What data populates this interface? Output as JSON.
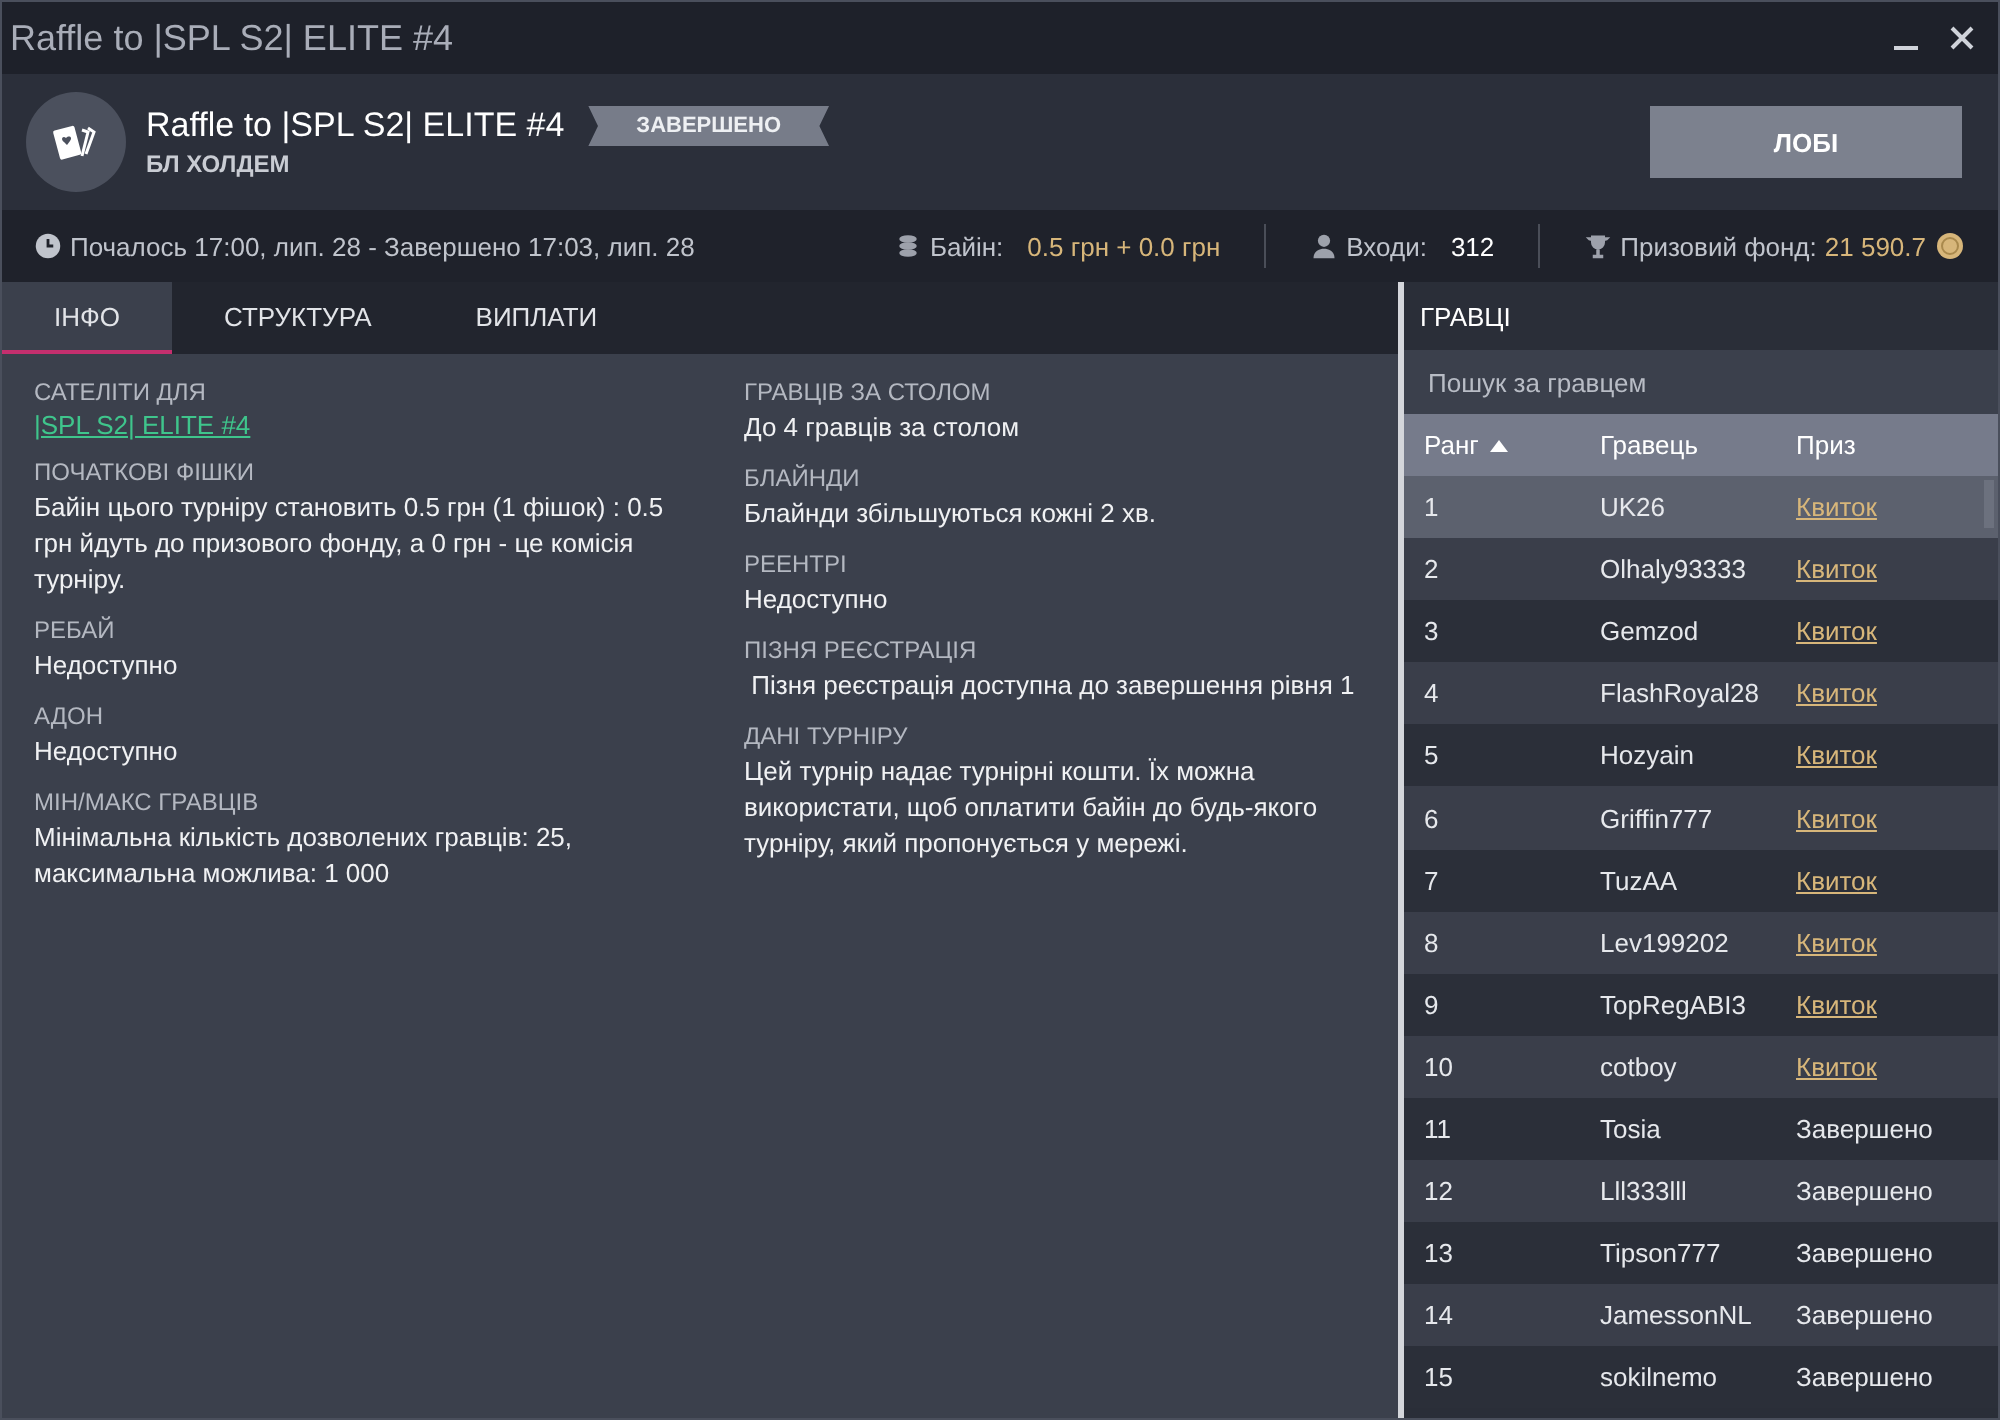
{
  "window": {
    "title": "Raffle to |SPL S2| ELITE #4"
  },
  "header": {
    "title": "Raffle to |SPL S2| ELITE #4",
    "status": "ЗАВЕРШЕНО",
    "game": "БЛ ХОЛДЕМ",
    "lobby_button": "ЛОБІ"
  },
  "info_bar": {
    "time": "Почалось 17:00, лип. 28  -  Завершено 17:03, лип. 28",
    "buyin_label": "Байін:",
    "buyin_value": "0.5 грн + 0.0 грн",
    "entries_label": "Входи:",
    "entries_value": "312",
    "prize_label": "Призовий фонд:",
    "prize_value": "21 590.7"
  },
  "tabs": [
    {
      "label": "ІНФО",
      "selected": true
    },
    {
      "label": "СТРУКТУРА",
      "selected": false
    },
    {
      "label": "ВИПЛАТИ",
      "selected": false
    }
  ],
  "info_columns": [
    [
      {
        "label": "САТЕЛІТИ ДЛЯ",
        "value": "|SPL S2| ELITE #4",
        "kind": "link"
      },
      {
        "label": "ПОЧАТКОВІ ФІШКИ",
        "value": "Байін цього турніру становить 0.5 грн (1 фішок) : 0.5 грн йдуть до призового фонду, а 0 грн - це комісія турніру.",
        "kind": "text"
      },
      {
        "label": "РЕБАЙ",
        "value": "Недоступно",
        "kind": "text"
      },
      {
        "label": "АДОН",
        "value": "Недоступно",
        "kind": "text"
      },
      {
        "label": "МІН/МАКС ГРАВЦІВ",
        "value": "Мінімальна кількість дозволених гравців: 25, максимальна можлива: 1 000",
        "kind": "text"
      }
    ],
    [
      {
        "label": "ГРАВЦІВ ЗА СТОЛОМ",
        "value": "До 4 гравців за столом",
        "kind": "text"
      },
      {
        "label": "БЛАЙНДИ",
        "value": "Блайнди збільшуються кожні 2 хв.",
        "kind": "text"
      },
      {
        "label": "РЕЕНТРІ",
        "value": "Недоступно",
        "kind": "text"
      },
      {
        "label": "ПІЗНЯ РЕЄСТРАЦІЯ",
        "value": " Пізня реєстрація доступна до завершення рівня 1",
        "kind": "text"
      },
      {
        "label": "ДАНІ ТУРНІРУ",
        "value": "Цей турнір надає турнірні кошти. Їх можна використати, щоб оплатити байін до будь-якого турніру, який пропонується у мережі.",
        "kind": "text"
      }
    ]
  ],
  "players": {
    "title": "ГРАВЦІ",
    "search": {
      "placeholder": "Пошук за гравцем"
    },
    "columns": [
      {
        "label": "Ранг",
        "sorted": true
      },
      {
        "label": "Гравець",
        "sorted": false
      },
      {
        "label": "Приз",
        "sorted": false
      }
    ],
    "rows": [
      {
        "rank": "1",
        "name": "UK26",
        "prize": "Квиток",
        "kind": "link",
        "selected": true
      },
      {
        "rank": "2",
        "name": "Olhaly93333",
        "prize": "Квиток",
        "kind": "link",
        "selected": false
      },
      {
        "rank": "3",
        "name": "Gemzod",
        "prize": "Квиток",
        "kind": "link",
        "selected": false
      },
      {
        "rank": "4",
        "name": "FlashRoyal28",
        "prize": "Квиток",
        "kind": "link",
        "selected": false
      },
      {
        "rank": "5",
        "name": "Hozyain",
        "prize": "Квиток",
        "kind": "link",
        "selected": false
      },
      {
        "rank": "6",
        "name": "Griffin777",
        "prize": "Квиток",
        "kind": "link",
        "selected": false
      },
      {
        "rank": "7",
        "name": "TuzAA",
        "prize": "Квиток",
        "kind": "link",
        "selected": false
      },
      {
        "rank": "8",
        "name": "Lev199202",
        "prize": "Квиток",
        "kind": "link",
        "selected": false
      },
      {
        "rank": "9",
        "name": "TopRegABI3",
        "prize": "Квиток",
        "kind": "link",
        "selected": false
      },
      {
        "rank": "10",
        "name": "cotboy",
        "prize": "Квиток",
        "kind": "link",
        "selected": false
      },
      {
        "rank": "11",
        "name": "Tosia",
        "prize": "Завершено",
        "kind": "text",
        "selected": false
      },
      {
        "rank": "12",
        "name": "Lll333lll",
        "prize": "Завершено",
        "kind": "text",
        "selected": false
      },
      {
        "rank": "13",
        "name": "Tipson777",
        "prize": "Завершено",
        "kind": "text",
        "selected": false
      },
      {
        "rank": "14",
        "name": "JamessonNL",
        "prize": "Завершено",
        "kind": "text",
        "selected": false
      },
      {
        "rank": "15",
        "name": "sokilnemo",
        "prize": "Завершено",
        "kind": "text",
        "selected": false
      }
    ]
  }
}
